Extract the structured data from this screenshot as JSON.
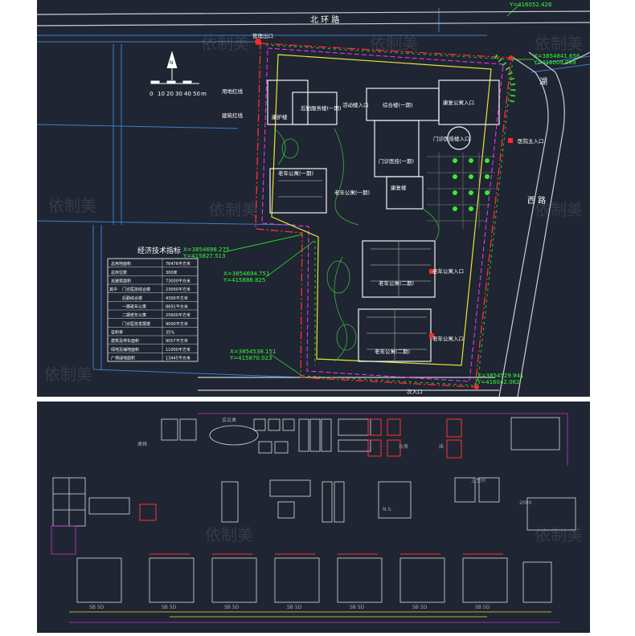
{
  "site_plan": {
    "road_north": "北 环 路",
    "road_east": "西 路",
    "road_east_top": "湖",
    "scale_ticks": [
      "0",
      "10",
      "20",
      "30",
      "40",
      "50",
      "m"
    ],
    "north_symbol": "N",
    "coords": {
      "c1": "Y=416052.426",
      "c2a": "X=3854841.656",
      "c2b": "Y=416009.089",
      "c3a": "X=3854698.275",
      "c3b": "Y=415827.513",
      "c4a": "X=3854694.751",
      "c4b": "Y=415886.825",
      "c5a": "X=3854538.151",
      "c5b": "Y=415870.023",
      "c6a": "X=3854529.941",
      "c6b": "Y=416042.062"
    },
    "labels": {
      "north_gate": "管理出口",
      "line1": "用地红线",
      "line2": "建筑红线",
      "bldg_service": "后勤服务楼(一期)",
      "bldg_care": "康护楼",
      "bldg_activity": "活动楼入口",
      "bldg_comprehensive": "综合楼(一期)",
      "bldg_apartment_top": "老年公寓(一期)",
      "bldg_outpatient": "门诊医技(一期)",
      "outpatient_entry": "门诊医技楼入口",
      "east_main_entry": "医院主入口",
      "bldg_old_apt1": "老年公寓(一期)",
      "old_apt_entry": "老年公寓入口",
      "bldg_rehab": "康复楼",
      "bldg_apt2": "老年公寓(二期)",
      "bldg_apt2b": "老年公寓(二期)",
      "apt2_entry": "老年公寓入口",
      "apt2b_entry": "老年公寓入口",
      "south_entry": "次入口",
      "east_apt": "康复公寓入口"
    },
    "table": {
      "title": "经济技术指标",
      "rows": [
        [
          "总用地面积",
          "76476平方米"
        ],
        [
          "总床位数",
          "300床"
        ],
        [
          "总建筑面积",
          "73000平方米"
        ],
        [
          "其中",
          "门诊医技综合楼",
          "23000平方米"
        ],
        [
          "",
          "后勤综合楼",
          "4300平方米"
        ],
        [
          "",
          "一期老年公寓",
          "8691平方米"
        ],
        [
          "",
          "二期老年公寓",
          "25600平方米"
        ],
        [
          "",
          "门诊医技发展楼",
          "9000平方米"
        ],
        [
          "容积率",
          "35%"
        ],
        [
          "建筑及停车面积",
          "9057平方米"
        ],
        [
          "绿地及铺地面积",
          "11000平方米"
        ],
        [
          "广场绿地面积",
          "13445平方米"
        ]
      ]
    }
  },
  "blocks": {
    "labels": [
      "桌椅",
      "会议桌",
      "沙发",
      "床",
      "卫生间",
      "N.S.",
      "2000",
      "SB 5D"
    ]
  },
  "watermarks": [
    "依制美",
    "依制美",
    "依制美",
    "依制美",
    "依制美",
    "依制美",
    "依制美",
    "依制美",
    "依制美"
  ],
  "colors": {
    "background": "#1f2532",
    "site_line": "#ff3333",
    "building": "#ffffff",
    "magenta": "#ff33ff",
    "yellow": "#ffff33",
    "green": "#33ff33",
    "cyan": "#33aaff"
  }
}
